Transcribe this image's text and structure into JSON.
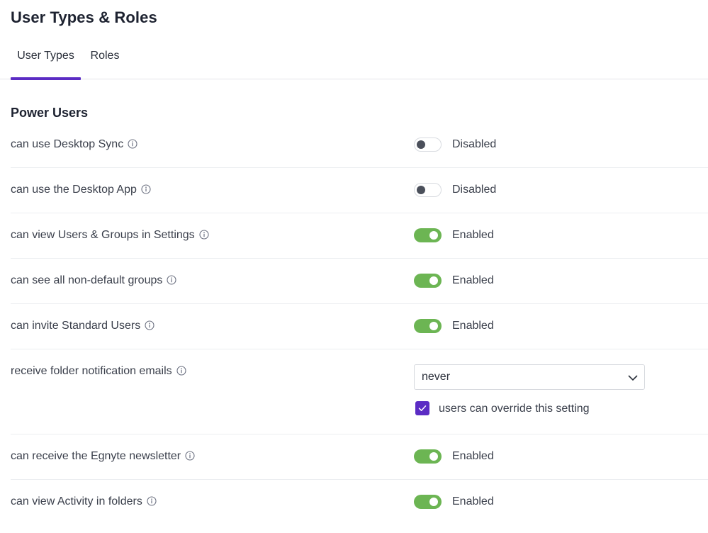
{
  "page": {
    "title": "User Types & Roles"
  },
  "tabs": [
    {
      "label": "User Types",
      "active": true
    },
    {
      "label": "Roles",
      "active": false
    }
  ],
  "section": {
    "title": "Power Users"
  },
  "settings": [
    {
      "label": "can use Desktop Sync",
      "control": "toggle",
      "enabled": false,
      "state": "Disabled"
    },
    {
      "label": "can use the Desktop App",
      "control": "toggle",
      "enabled": false,
      "state": "Disabled"
    },
    {
      "label": "can view Users & Groups in Settings",
      "control": "toggle",
      "enabled": true,
      "state": "Enabled"
    },
    {
      "label": "can see all non-default groups",
      "control": "toggle",
      "enabled": true,
      "state": "Enabled"
    },
    {
      "label": "can invite Standard Users",
      "control": "toggle",
      "enabled": true,
      "state": "Enabled"
    },
    {
      "label": "receive folder notification emails",
      "control": "select",
      "selected": "never",
      "override_checked": true,
      "override_label": "users can override this setting"
    },
    {
      "label": "can receive the Egnyte newsletter",
      "control": "toggle",
      "enabled": true,
      "state": "Enabled"
    },
    {
      "label": "can view Activity in folders",
      "control": "toggle",
      "enabled": true,
      "state": "Enabled"
    }
  ],
  "icons": {
    "info": "info-circle-icon",
    "dropdown": "chevron-down-icon",
    "check": "checkmark-icon"
  },
  "colors": {
    "accent": "#5b2cc4",
    "toggle_on": "#6cb553",
    "toggle_off_knob": "#4b505b"
  }
}
